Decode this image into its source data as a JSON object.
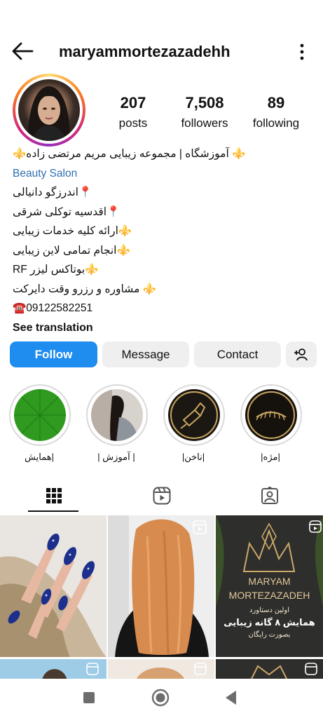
{
  "header": {
    "username": "maryammortezazadehh"
  },
  "stats": [
    {
      "value": "207",
      "label": "posts"
    },
    {
      "value": "7,508",
      "label": "followers"
    },
    {
      "value": "89",
      "label": "following"
    }
  ],
  "bio": {
    "title": "⚜️ آموزشگاه | مجموعه زیبایی مریم مرتضی زاده⚜️",
    "category": "Beauty Salon",
    "lines": [
      "📍اندرزگو دانیالی",
      "📍اقدسیه توکلی شرقی",
      "⚜️ارائه کلیه خدمات زیبایی",
      "⚜️انجام تمامی لاین زیبایی",
      "⚜️بوتاکس لیزر RF",
      "⚜️ مشاوره و رزرو وقت دایرکت",
      "☎️09122582251"
    ],
    "see_translation": "See translation"
  },
  "buttons": {
    "follow": "Follow",
    "message": "Message",
    "contact": "Contact"
  },
  "highlights": [
    {
      "label": "|همایش"
    },
    {
      "label": "| آموزش |"
    },
    {
      "label": "|ناخن|"
    },
    {
      "label": "|مژه|"
    }
  ],
  "posts": {
    "poster_line1": "MARYAM",
    "poster_line2": "MORTEZAZADEH",
    "poster_line3": "اولین دستاورد",
    "poster_line4": "همایش ۸ گانه زیبایی",
    "poster_line5": "بصورت رایگان"
  },
  "colors": {
    "follow_button": "#1f8cf0",
    "link": "#2f6fb0",
    "button_gray": "#efefef"
  },
  "icons": [
    "back-arrow-icon",
    "more-vertical-icon",
    "add-person-icon",
    "grid-icon",
    "reels-icon",
    "tagged-icon",
    "reel-badge-icon",
    "nav-square-icon",
    "nav-circle-icon",
    "nav-back-icon"
  ]
}
